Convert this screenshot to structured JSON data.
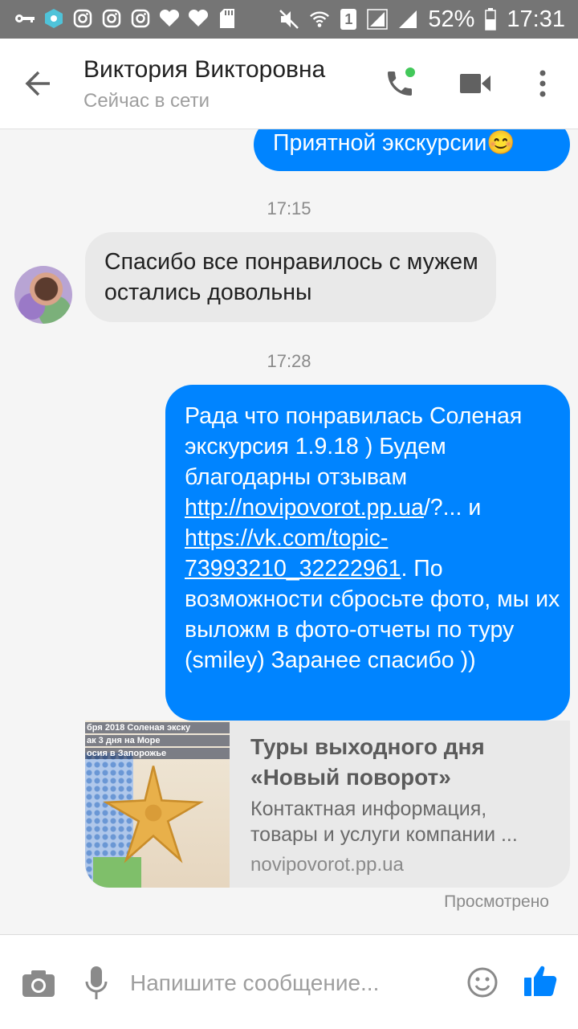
{
  "status_bar": {
    "time": "17:31",
    "battery": "52%",
    "sim": "1",
    "icons": [
      "key-icon",
      "vpn-icon",
      "instagram-icon",
      "instagram-icon",
      "instagram-icon",
      "heart-icon",
      "heart-icon",
      "sd-card-icon",
      "mute-icon",
      "wifi-icon",
      "sim-icon",
      "signal-icon",
      "signal-icon",
      "battery-icon"
    ]
  },
  "header": {
    "contact_name": "Виктория Викторовна",
    "status": "Сейчас в сети",
    "accent": "#42c85a"
  },
  "messages": {
    "m1": "Приятной экскурсии😊",
    "time1": "17:15",
    "m2": "Спасибо все понравилось с мужем остались довольны",
    "time2": "17:28",
    "m3_part1": "Рада что понравилась Соленая экскурсия 1.9.18 ) Будем благодарны отзывам ",
    "m3_link1": "http://novipovorot.pp.ua",
    "m3_part2": "/?... и ",
    "m3_link2": "https://vk.com/topic-73993210_32222961",
    "m3_part3": ". По возможности сбросьте фото, мы их выложм в фото-отчеты по туру (smiley)  Заранее спасибо ))"
  },
  "link_preview": {
    "title": "Туры выходного дня «Новый поворот»",
    "desc_line1": "Контактная информация,",
    "desc_line2": "товары и услуги компании ...",
    "url": "novipovorot.pp.ua",
    "image_caption1": "бря 2018 Соленая экску",
    "image_caption2": "ак 3 дня на Море",
    "image_caption3": "осия в Запорожье"
  },
  "seen_label": "Просмотрено",
  "composer": {
    "placeholder": "Напишите сообщение..."
  },
  "colors": {
    "bubble_out": "#0084ff",
    "bubble_in": "#e9e9e9",
    "status_bar": "#757575"
  }
}
